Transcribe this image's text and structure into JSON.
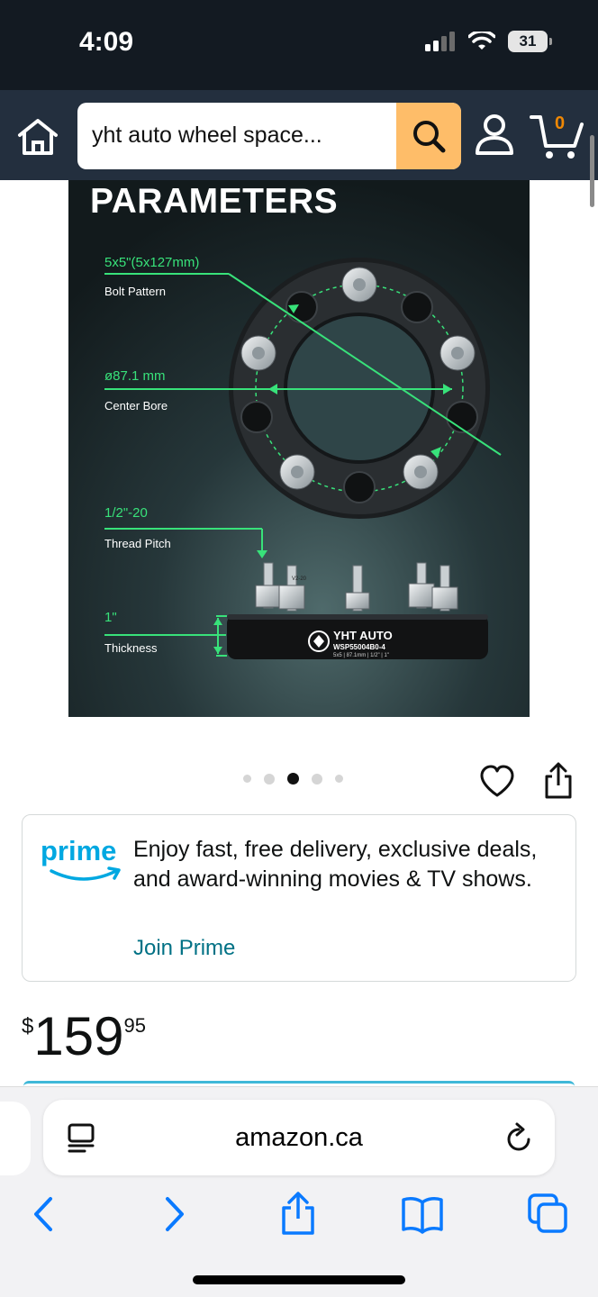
{
  "status_bar": {
    "time": "4:09",
    "battery": "31"
  },
  "header": {
    "search_value": "yht auto wheel space...",
    "cart_count": "0",
    "icons": [
      "home-icon",
      "search-icon",
      "account-icon",
      "cart-icon"
    ]
  },
  "product_image": {
    "heading": "PARAMETERS",
    "specs": [
      {
        "value": "5x5\"(5x127mm)",
        "label": "Bolt Pattern"
      },
      {
        "value": "ø87.1 mm",
        "label": "Center Bore"
      },
      {
        "value": "1/2\"-20",
        "label": "Thread Pitch"
      },
      {
        "value": "1\"",
        "label": "Thickness"
      }
    ],
    "brand": "YHT AUTO",
    "part_number": "WSP55004B0-4",
    "part_specs": "5x5 | 87.1mm | 1/2\" | 1\"",
    "stud_mark": "V2-20",
    "accent_color": "#38e27a"
  },
  "carousel": {
    "total": 5,
    "active_index": 2
  },
  "prime": {
    "logo": "prime",
    "message": "Enjoy fast, free delivery, exclusive deals, and award-winning movies & TV shows.",
    "link": "Join Prime"
  },
  "price": {
    "symbol": "$",
    "whole": "159",
    "fraction": "95"
  },
  "browser": {
    "url": "amazon.ca",
    "icons": [
      "reader-icon",
      "reload-icon",
      "back-icon",
      "forward-icon",
      "share-icon",
      "bookmarks-icon",
      "tabs-icon"
    ]
  }
}
